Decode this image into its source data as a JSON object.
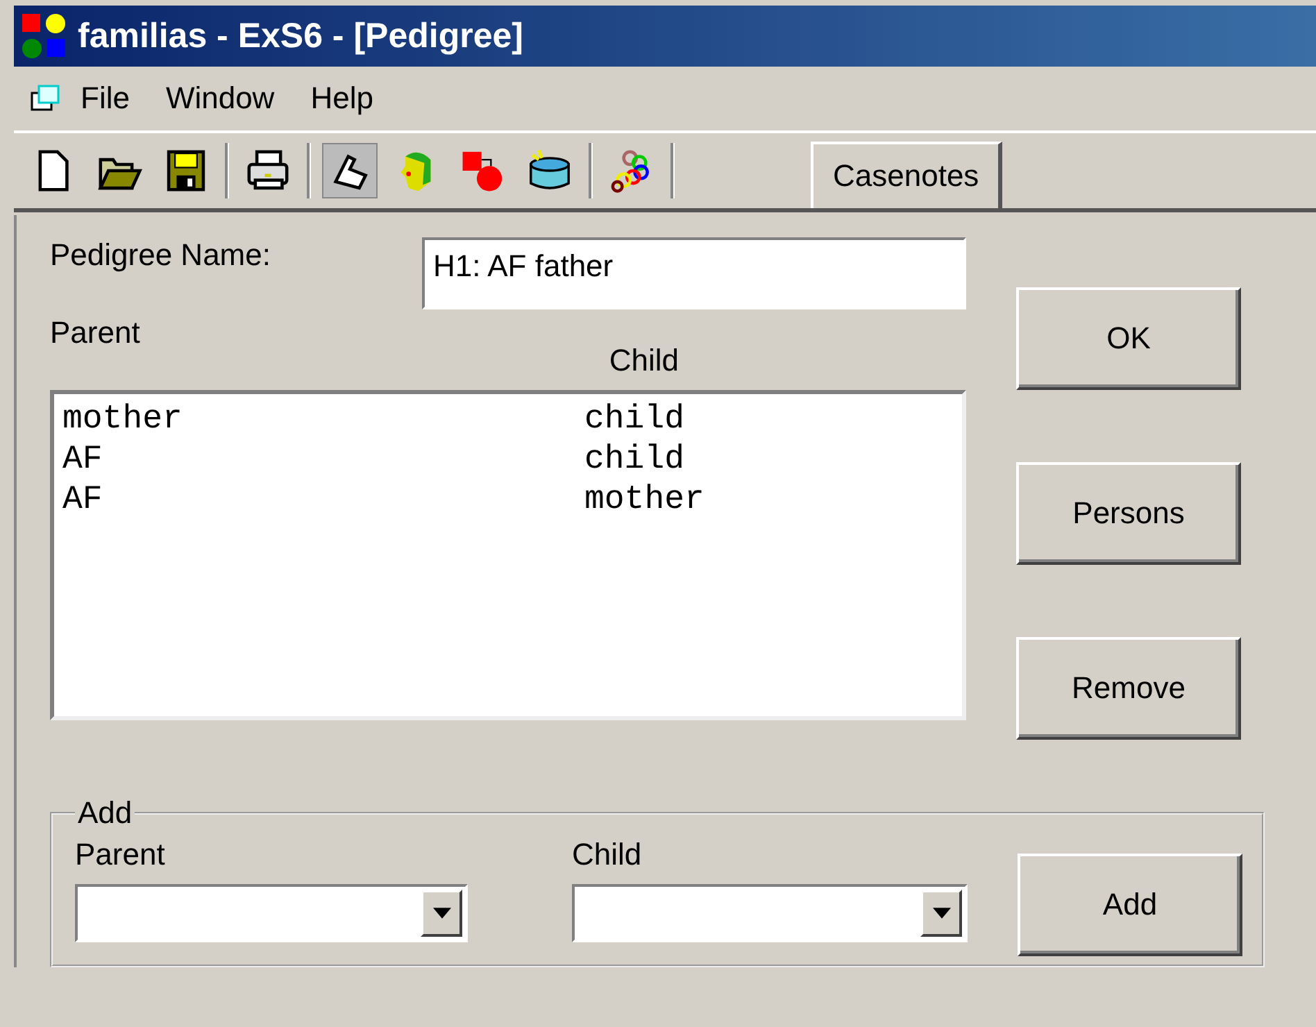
{
  "window": {
    "title": "familias - ExS6 - [Pedigree]"
  },
  "menu": [
    "File",
    "Window",
    "Help"
  ],
  "toolbar": [
    {
      "kind": "new",
      "pressed": false
    },
    {
      "kind": "open",
      "pressed": false
    },
    {
      "kind": "save",
      "pressed": false
    },
    {
      "kind": "separator"
    },
    {
      "kind": "print",
      "pressed": false
    },
    {
      "kind": "separator"
    },
    {
      "kind": "phone",
      "pressed": true
    },
    {
      "kind": "head",
      "pressed": false
    },
    {
      "kind": "shapes",
      "pressed": false
    },
    {
      "kind": "drum",
      "pressed": false
    },
    {
      "kind": "separator"
    },
    {
      "kind": "rings",
      "pressed": false
    }
  ],
  "casenotes_tab": "Casenotes",
  "pedigree_name": {
    "label": "Pedigree Name:",
    "value": "H1: AF father"
  },
  "list": {
    "parent_header": "Parent",
    "child_header": "Child",
    "rows": [
      {
        "parent": "mother",
        "child": "child"
      },
      {
        "parent": "AF",
        "child": "child"
      },
      {
        "parent": "AF",
        "child": "mother"
      }
    ]
  },
  "buttons": [
    "OK",
    "Persons",
    "Remove"
  ],
  "add_group": {
    "title": "Add",
    "parent_label": "Parent",
    "child_label": "Child",
    "button": "Add"
  }
}
